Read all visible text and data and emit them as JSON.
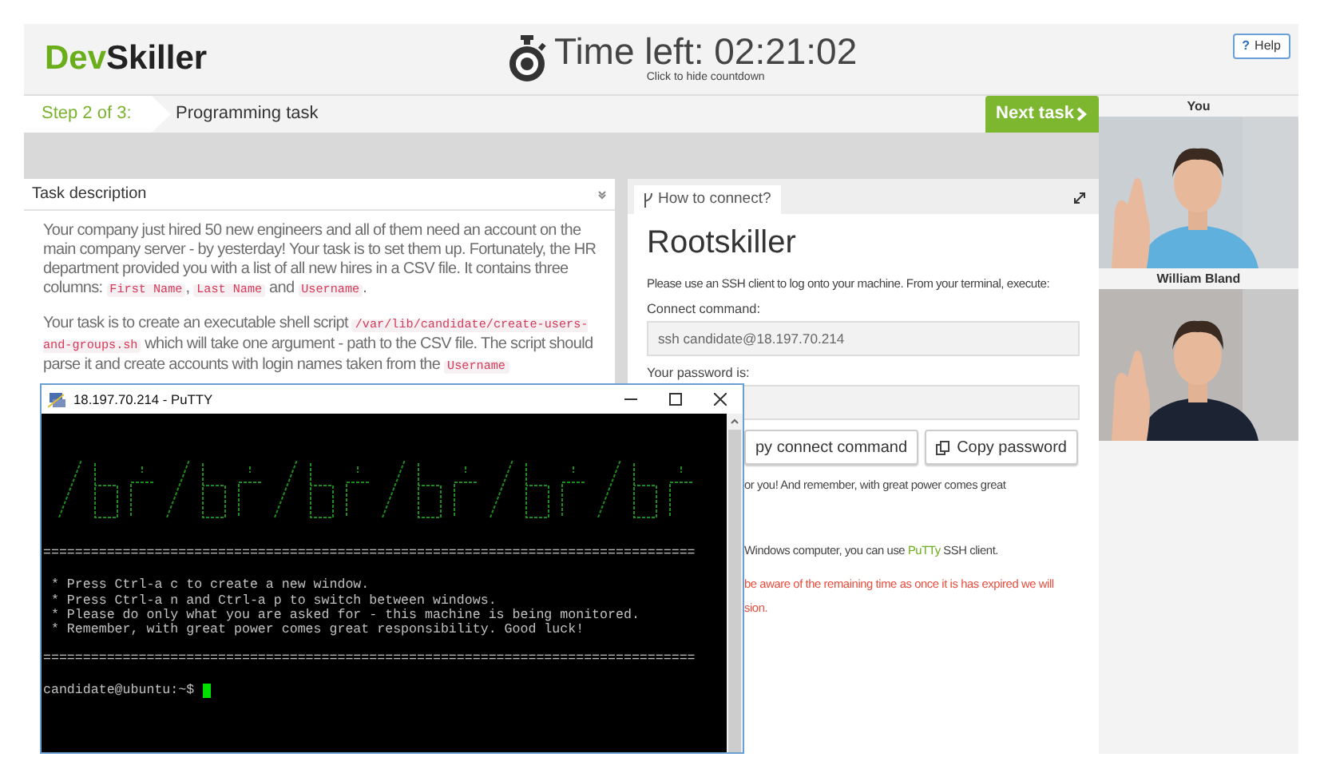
{
  "logo": [
    {
      "text": "Dev",
      "color": "#6aae1c"
    },
    {
      "text": "Skiller",
      "color": "#222222"
    }
  ],
  "timer": {
    "text": "Time left: 02:21:02",
    "hint": "Click to hide countdown"
  },
  "help_button": {
    "icon": "?",
    "label": "Help"
  },
  "steps": {
    "step": "Step 2 of 3:",
    "title": "Programming task",
    "next_button": "Next task"
  },
  "task_panel": {
    "title": "Task description",
    "paragraphs": [
      [
        {
          "kind": "plain",
          "text": "Your company just hired 50 new engineers and all of them need an account on the main company server - by yesterday! Your task is to set them up. Fortunately, the HR department provided you with a list of all new hires in a CSV file. It contains three columns: "
        },
        {
          "kind": "code",
          "text": "First Name"
        },
        {
          "kind": "plain",
          "text": ", "
        },
        {
          "kind": "code",
          "text": "Last Name"
        },
        {
          "kind": "plain",
          "text": " and "
        },
        {
          "kind": "code",
          "text": "Username"
        },
        {
          "kind": "plain",
          "text": "."
        }
      ],
      [
        {
          "kind": "plain",
          "text": "Your task is to create an executable shell script "
        },
        {
          "kind": "code",
          "text": "/var/lib/candidate/create-users-and-groups.sh"
        },
        {
          "kind": "plain",
          "text": " which will take one argument - path to the CSV file. The script should parse it and create accounts with login names taken from the "
        },
        {
          "kind": "code",
          "text": "Username"
        }
      ]
    ]
  },
  "connect_panel": {
    "tab": "How to connect?",
    "title": "Rootskiller",
    "intro": "Please use an SSH client to log onto your machine. From your terminal, execute:",
    "fields": [
      {
        "label": "Connect command:",
        "value": "ssh candidate@18.197.70.214"
      },
      {
        "label": "Your password is:"
      }
    ],
    "buttons": [
      {
        "label": "py connect command",
        "icon": false
      },
      {
        "label": "Copy password",
        "icon": true
      }
    ],
    "lines": [
      {
        "kind": "plain",
        "text": "or you! And remember, with great power comes great"
      },
      {
        "kind": "link",
        "before": "Windows computer, you can use ",
        "link": "PuTTy",
        "after": " SSH client."
      },
      {
        "kind": "warning",
        "text": "be aware of the remaining time as once it is has expired we will"
      },
      {
        "kind": "warning",
        "text": "sion."
      }
    ]
  },
  "videos": [
    {
      "name": "You"
    },
    {
      "name": "William Bland"
    }
  ],
  "putty": {
    "title": "18.197.70.214 - PuTTY",
    "separator": "==================================================================================",
    "messages": [
      " * Press Ctrl-a c to create a new window.",
      " * Press Ctrl-a n and Ctrl-a p to switch between windows.",
      " * Please do only what you are asked for - this machine is being monitored.",
      " * Remember, with great power comes great responsibility. Good luck!"
    ],
    "prompt": "candidate@ubuntu:~$"
  }
}
